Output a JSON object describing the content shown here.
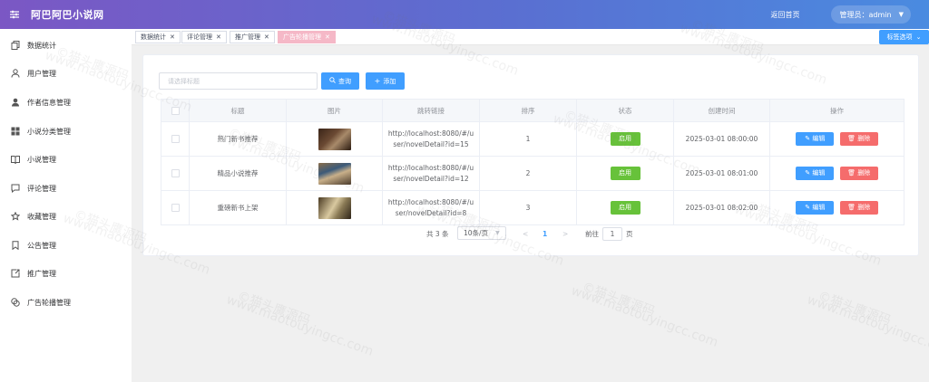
{
  "header": {
    "title": "阿巴阿巴小说网",
    "home_link": "返回首页",
    "user_label": "管理员：admin",
    "gradient_colors": [
      "#7b57c4",
      "#4a8be0"
    ]
  },
  "sidebar": {
    "items": [
      {
        "label": "数据统计",
        "icon": "copy-icon"
      },
      {
        "label": "用户管理",
        "icon": "user-icon"
      },
      {
        "label": "作者信息管理",
        "icon": "user-filled-icon"
      },
      {
        "label": "小说分类管理",
        "icon": "grid-icon"
      },
      {
        "label": "小说管理",
        "icon": "book-icon"
      },
      {
        "label": "评论管理",
        "icon": "chat-icon"
      },
      {
        "label": "收藏管理",
        "icon": "star-icon"
      },
      {
        "label": "公告管理",
        "icon": "bookmark-icon"
      },
      {
        "label": "推广管理",
        "icon": "share-icon"
      },
      {
        "label": "广告轮播管理",
        "icon": "layers-icon"
      }
    ]
  },
  "tags": {
    "items": [
      {
        "label": "数据统计",
        "active": false
      },
      {
        "label": "评论管理",
        "active": false
      },
      {
        "label": "推广管理",
        "active": false
      },
      {
        "label": "广告轮播管理",
        "active": true
      }
    ],
    "options_label": "标签选项"
  },
  "toolbar": {
    "search_placeholder": "请选择标题",
    "search_button": "查询",
    "add_button": "添加"
  },
  "table": {
    "columns": [
      "标题",
      "图片",
      "跳转链接",
      "排序",
      "状态",
      "创建时间",
      "操作"
    ],
    "rows": [
      {
        "title": "热门新书推荐",
        "link": "http://localhost:8080/#/user/novelDetail?id=15",
        "sort": "1",
        "status": "启用",
        "created": "2025-03-01 08:00:00"
      },
      {
        "title": "精品小说推荐",
        "link": "http://localhost:8080/#/user/novelDetail?id=12",
        "sort": "2",
        "status": "启用",
        "created": "2025-03-01 08:01:00"
      },
      {
        "title": "重磅新书上架",
        "link": "http://localhost:8080/#/user/novelDetail?id=8",
        "sort": "3",
        "status": "启用",
        "created": "2025-03-01 08:02:00"
      }
    ],
    "edit_label": "编辑",
    "delete_label": "删除",
    "status_color": "#67c23a",
    "edit_color": "#409eff",
    "delete_color": "#f56c6c"
  },
  "pagination": {
    "total_text": "共 3 条",
    "page_size": "10条/页",
    "current_page": "1",
    "goto_label": "前往",
    "goto_value": "1",
    "page_suffix": "页"
  },
  "watermark": {
    "cn": "©猫头鹰源码",
    "en": "www.maotouyingcc.com"
  }
}
